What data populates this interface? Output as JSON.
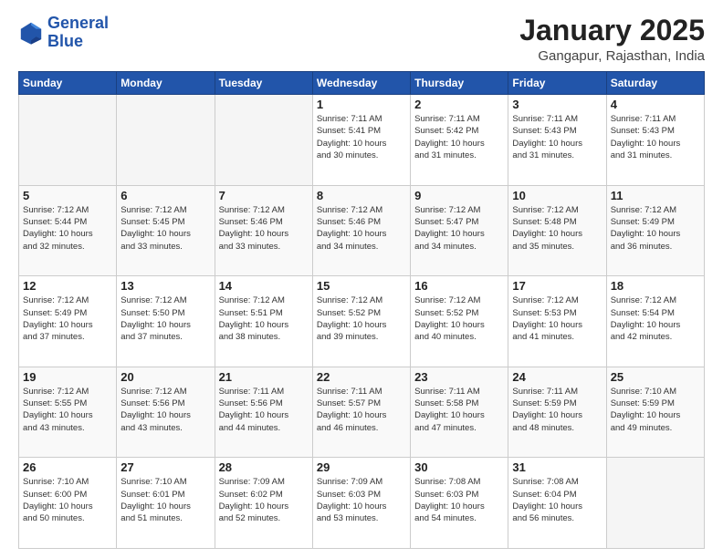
{
  "header": {
    "logo_line1": "General",
    "logo_line2": "Blue",
    "title": "January 2025",
    "subtitle": "Gangapur, Rajasthan, India"
  },
  "weekdays": [
    "Sunday",
    "Monday",
    "Tuesday",
    "Wednesday",
    "Thursday",
    "Friday",
    "Saturday"
  ],
  "weeks": [
    [
      {
        "day": "",
        "info": ""
      },
      {
        "day": "",
        "info": ""
      },
      {
        "day": "",
        "info": ""
      },
      {
        "day": "1",
        "info": "Sunrise: 7:11 AM\nSunset: 5:41 PM\nDaylight: 10 hours\nand 30 minutes."
      },
      {
        "day": "2",
        "info": "Sunrise: 7:11 AM\nSunset: 5:42 PM\nDaylight: 10 hours\nand 31 minutes."
      },
      {
        "day": "3",
        "info": "Sunrise: 7:11 AM\nSunset: 5:43 PM\nDaylight: 10 hours\nand 31 minutes."
      },
      {
        "day": "4",
        "info": "Sunrise: 7:11 AM\nSunset: 5:43 PM\nDaylight: 10 hours\nand 31 minutes."
      }
    ],
    [
      {
        "day": "5",
        "info": "Sunrise: 7:12 AM\nSunset: 5:44 PM\nDaylight: 10 hours\nand 32 minutes."
      },
      {
        "day": "6",
        "info": "Sunrise: 7:12 AM\nSunset: 5:45 PM\nDaylight: 10 hours\nand 33 minutes."
      },
      {
        "day": "7",
        "info": "Sunrise: 7:12 AM\nSunset: 5:46 PM\nDaylight: 10 hours\nand 33 minutes."
      },
      {
        "day": "8",
        "info": "Sunrise: 7:12 AM\nSunset: 5:46 PM\nDaylight: 10 hours\nand 34 minutes."
      },
      {
        "day": "9",
        "info": "Sunrise: 7:12 AM\nSunset: 5:47 PM\nDaylight: 10 hours\nand 34 minutes."
      },
      {
        "day": "10",
        "info": "Sunrise: 7:12 AM\nSunset: 5:48 PM\nDaylight: 10 hours\nand 35 minutes."
      },
      {
        "day": "11",
        "info": "Sunrise: 7:12 AM\nSunset: 5:49 PM\nDaylight: 10 hours\nand 36 minutes."
      }
    ],
    [
      {
        "day": "12",
        "info": "Sunrise: 7:12 AM\nSunset: 5:49 PM\nDaylight: 10 hours\nand 37 minutes."
      },
      {
        "day": "13",
        "info": "Sunrise: 7:12 AM\nSunset: 5:50 PM\nDaylight: 10 hours\nand 37 minutes."
      },
      {
        "day": "14",
        "info": "Sunrise: 7:12 AM\nSunset: 5:51 PM\nDaylight: 10 hours\nand 38 minutes."
      },
      {
        "day": "15",
        "info": "Sunrise: 7:12 AM\nSunset: 5:52 PM\nDaylight: 10 hours\nand 39 minutes."
      },
      {
        "day": "16",
        "info": "Sunrise: 7:12 AM\nSunset: 5:52 PM\nDaylight: 10 hours\nand 40 minutes."
      },
      {
        "day": "17",
        "info": "Sunrise: 7:12 AM\nSunset: 5:53 PM\nDaylight: 10 hours\nand 41 minutes."
      },
      {
        "day": "18",
        "info": "Sunrise: 7:12 AM\nSunset: 5:54 PM\nDaylight: 10 hours\nand 42 minutes."
      }
    ],
    [
      {
        "day": "19",
        "info": "Sunrise: 7:12 AM\nSunset: 5:55 PM\nDaylight: 10 hours\nand 43 minutes."
      },
      {
        "day": "20",
        "info": "Sunrise: 7:12 AM\nSunset: 5:56 PM\nDaylight: 10 hours\nand 43 minutes."
      },
      {
        "day": "21",
        "info": "Sunrise: 7:11 AM\nSunset: 5:56 PM\nDaylight: 10 hours\nand 44 minutes."
      },
      {
        "day": "22",
        "info": "Sunrise: 7:11 AM\nSunset: 5:57 PM\nDaylight: 10 hours\nand 46 minutes."
      },
      {
        "day": "23",
        "info": "Sunrise: 7:11 AM\nSunset: 5:58 PM\nDaylight: 10 hours\nand 47 minutes."
      },
      {
        "day": "24",
        "info": "Sunrise: 7:11 AM\nSunset: 5:59 PM\nDaylight: 10 hours\nand 48 minutes."
      },
      {
        "day": "25",
        "info": "Sunrise: 7:10 AM\nSunset: 5:59 PM\nDaylight: 10 hours\nand 49 minutes."
      }
    ],
    [
      {
        "day": "26",
        "info": "Sunrise: 7:10 AM\nSunset: 6:00 PM\nDaylight: 10 hours\nand 50 minutes."
      },
      {
        "day": "27",
        "info": "Sunrise: 7:10 AM\nSunset: 6:01 PM\nDaylight: 10 hours\nand 51 minutes."
      },
      {
        "day": "28",
        "info": "Sunrise: 7:09 AM\nSunset: 6:02 PM\nDaylight: 10 hours\nand 52 minutes."
      },
      {
        "day": "29",
        "info": "Sunrise: 7:09 AM\nSunset: 6:03 PM\nDaylight: 10 hours\nand 53 minutes."
      },
      {
        "day": "30",
        "info": "Sunrise: 7:08 AM\nSunset: 6:03 PM\nDaylight: 10 hours\nand 54 minutes."
      },
      {
        "day": "31",
        "info": "Sunrise: 7:08 AM\nSunset: 6:04 PM\nDaylight: 10 hours\nand 56 minutes."
      },
      {
        "day": "",
        "info": ""
      }
    ]
  ]
}
